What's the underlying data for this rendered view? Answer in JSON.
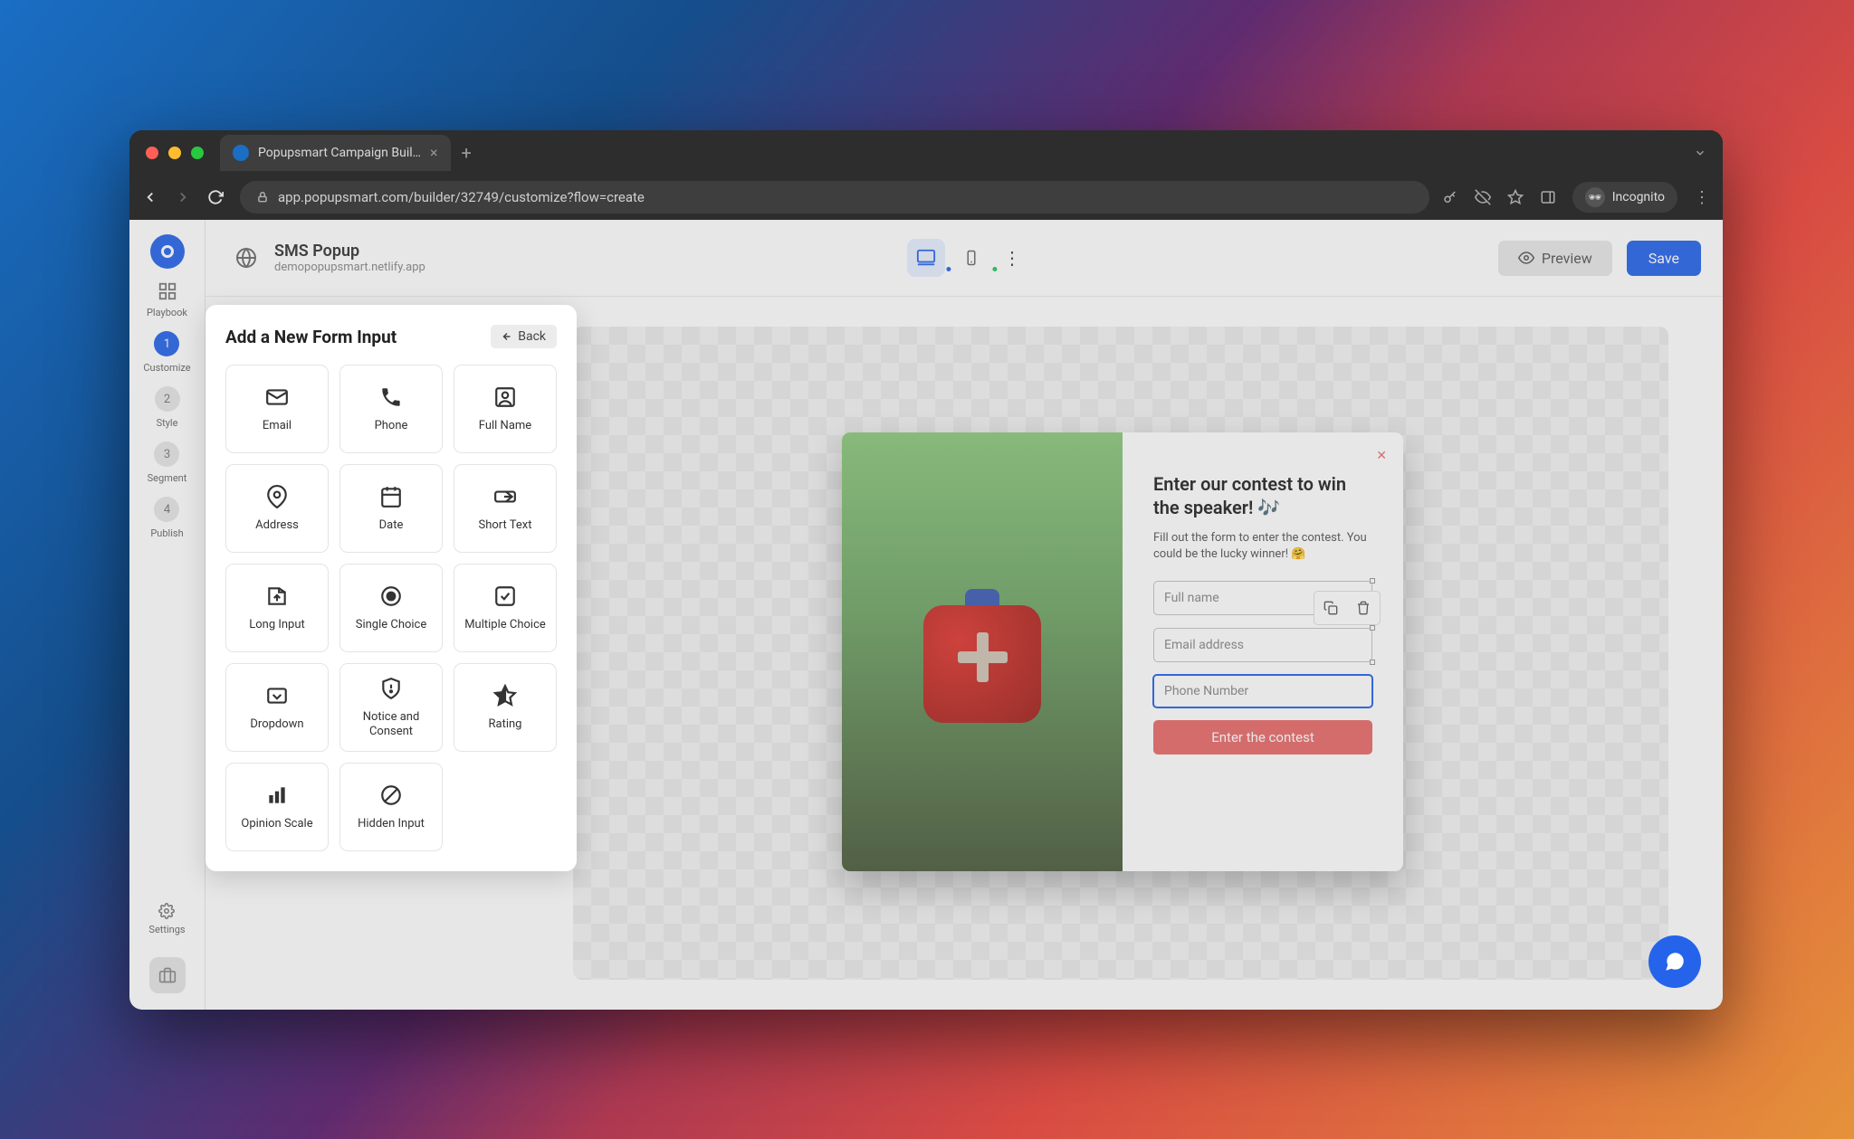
{
  "browser": {
    "tab_title": "Popupsmart Campaign Builder",
    "url": "app.popupsmart.com/builder/32749/customize?flow=create",
    "incognito_label": "Incognito"
  },
  "appbar": {
    "title": "SMS Popup",
    "domain": "demopopupsmart.netlify.app",
    "preview_label": "Preview",
    "save_label": "Save"
  },
  "rail": {
    "steps": [
      {
        "num": "1",
        "label": "Customize",
        "active": true
      },
      {
        "num": "2",
        "label": "Style",
        "active": false
      },
      {
        "num": "3",
        "label": "Segment",
        "active": false
      },
      {
        "num": "4",
        "label": "Publish",
        "active": false
      }
    ],
    "playbook_label": "Playbook",
    "settings_label": "Settings"
  },
  "popover": {
    "title": "Add a New Form Input",
    "back_label": "Back",
    "items": [
      {
        "key": "email",
        "label": "Email"
      },
      {
        "key": "phone",
        "label": "Phone"
      },
      {
        "key": "fullname",
        "label": "Full Name"
      },
      {
        "key": "address",
        "label": "Address"
      },
      {
        "key": "date",
        "label": "Date"
      },
      {
        "key": "shorttext",
        "label": "Short Text"
      },
      {
        "key": "longinput",
        "label": "Long Input"
      },
      {
        "key": "singlechoice",
        "label": "Single Choice"
      },
      {
        "key": "multichoice",
        "label": "Multiple Choice"
      },
      {
        "key": "dropdown",
        "label": "Dropdown"
      },
      {
        "key": "notice",
        "label": "Notice and Consent"
      },
      {
        "key": "rating",
        "label": "Rating"
      },
      {
        "key": "opinion",
        "label": "Opinion Scale"
      },
      {
        "key": "hidden",
        "label": "Hidden Input"
      }
    ]
  },
  "popup_preview": {
    "title": "Enter our contest to win the speaker! 🎶",
    "description": "Fill out the form to enter the contest. You could be the lucky winner! 🤗",
    "field_fullname_placeholder": "Full name",
    "field_email_placeholder": "Email address",
    "field_phone_placeholder": "Phone Number",
    "cta_label": "Enter the contest",
    "close_symbol": "✕"
  }
}
